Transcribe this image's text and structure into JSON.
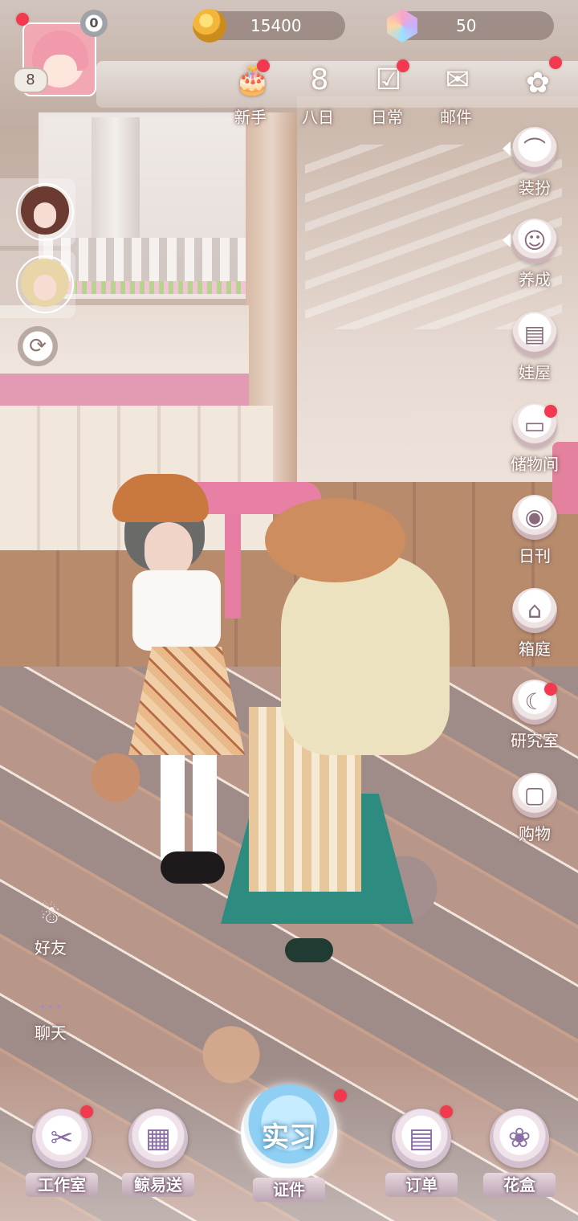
{
  "player": {
    "level": "8",
    "vip_level": "0",
    "avatar_icon": "player-avatar-pink-hair",
    "has_notification": true
  },
  "currencies": [
    {
      "name": "coin",
      "icon": "gold-coin-icon",
      "value": "15400"
    },
    {
      "name": "gem",
      "icon": "crystal-gem-icon",
      "value": "50"
    }
  ],
  "top_menu": [
    {
      "id": "newbie",
      "label": "新手",
      "icon": "gift-cake-icon",
      "glyph": "🎂",
      "badge": true
    },
    {
      "id": "eight-day",
      "label": "八日",
      "icon": "eight-day-calendar-icon",
      "glyph": "8",
      "badge": false
    },
    {
      "id": "daily",
      "label": "日常",
      "icon": "checklist-icon",
      "glyph": "☑",
      "badge": true
    },
    {
      "id": "mail",
      "label": "邮件",
      "icon": "mail-icon",
      "glyph": "✉",
      "badge": false
    },
    {
      "id": "more",
      "label": "",
      "icon": "flower-menu-icon",
      "glyph": "✿",
      "badge": true
    }
  ],
  "right_menu": [
    {
      "id": "dress-up",
      "label": "装扮",
      "icon": "hanger-icon",
      "glyph": "👗",
      "badge": false,
      "arrow": true
    },
    {
      "id": "nurture",
      "label": "养成",
      "icon": "doll-face-icon",
      "glyph": "☺",
      "badge": false,
      "arrow": true
    },
    {
      "id": "doll-house",
      "label": "娃屋",
      "icon": "cabinet-icon",
      "glyph": "▤",
      "badge": false,
      "arrow": false
    },
    {
      "id": "storage",
      "label": "储物间",
      "icon": "storage-box-icon",
      "glyph": "▭",
      "badge": true,
      "arrow": false
    },
    {
      "id": "daily-news",
      "label": "日刊",
      "icon": "camera-icon",
      "glyph": "◉",
      "badge": false,
      "arrow": false
    },
    {
      "id": "box-garden",
      "label": "箱庭",
      "icon": "house-lock-icon",
      "glyph": "⌂",
      "badge": false,
      "arrow": false
    },
    {
      "id": "lab",
      "label": "研究室",
      "icon": "moon-book-icon",
      "glyph": "☾",
      "badge": true,
      "arrow": false
    },
    {
      "id": "shop",
      "label": "购物",
      "icon": "shopping-bag-icon",
      "glyph": "👜",
      "badge": false,
      "arrow": false
    }
  ],
  "side_characters": [
    {
      "id": "char-brown",
      "icon": "doll-portrait-brown-hair",
      "hair_color": "#6b3a30"
    },
    {
      "id": "char-blonde",
      "icon": "doll-portrait-blonde-hair",
      "hair_color": "#e9d6a8"
    }
  ],
  "left_menu": [
    {
      "id": "friends",
      "label": "好友",
      "icon": "friends-icon",
      "glyph": "👥"
    },
    {
      "id": "chat",
      "label": "聊天",
      "icon": "chat-bubble-icon",
      "glyph": "💬"
    }
  ],
  "bottom_menu": [
    {
      "id": "studio",
      "label": "工作室",
      "icon": "scissors-book-icon",
      "glyph": "✂",
      "badge": true
    },
    {
      "id": "delivery",
      "label": "鲸易送",
      "icon": "delivery-box-icon",
      "glyph": "▦",
      "badge": false
    },
    {
      "id": "orders",
      "label": "订单",
      "icon": "order-paper-icon",
      "glyph": "📄",
      "badge": true
    },
    {
      "id": "flower-box",
      "label": "花盒",
      "icon": "flower-lock-icon",
      "glyph": "❀",
      "badge": false
    }
  ],
  "center_button": {
    "orb_text": "实习",
    "label": "证件",
    "badge": true
  },
  "colors": {
    "badge_red": "#f2394f",
    "text_white": "#ffffff"
  }
}
